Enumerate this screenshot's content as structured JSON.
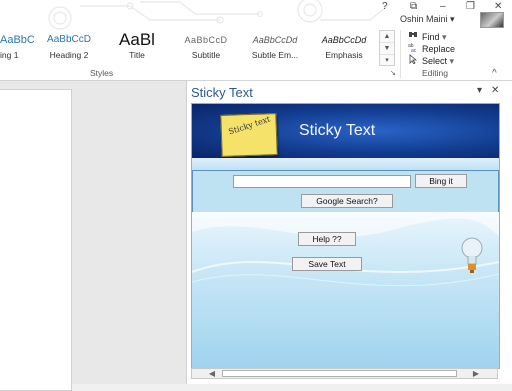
{
  "window": {
    "help": "?",
    "restore": "⧉",
    "minimize": "–",
    "maximize": "❐",
    "close": "✕",
    "user_name": "Oshin Maini",
    "user_menu_arrow": "▾"
  },
  "ribbon": {
    "styles": {
      "items": [
        {
          "sample": "AaBbCc",
          "name": "ing 1"
        },
        {
          "sample": "AaBbCcD",
          "name": "Heading 2"
        },
        {
          "sample": "AaBl",
          "name": "Title"
        },
        {
          "sample": "AaBbCcD",
          "name": "Subtitle"
        },
        {
          "sample": "AaBbCcDd",
          "name": "Subtle Em..."
        },
        {
          "sample": "AaBbCcDd",
          "name": "Emphasis"
        }
      ],
      "scroll_up": "▲",
      "scroll_down": "▼",
      "more": "▾",
      "group_label": "Styles",
      "launcher": "↘"
    },
    "editing": {
      "find": "Find",
      "find_arrow": "▾",
      "replace": "Replace",
      "select": "Select",
      "select_arrow": "▾",
      "group_label": "Editing",
      "collapse": "^"
    }
  },
  "pane": {
    "title": "Sticky Text",
    "menu_arrow": "▾",
    "close": "✕",
    "addin": {
      "note_text": "Sticky text",
      "banner_title": "Sticky Text",
      "search_value": "",
      "bing_button": "Bing it",
      "google_button": "Google Search?",
      "help_button": "Help ??",
      "save_button": "Save Text"
    },
    "scroll_left": "◀",
    "scroll_right": "▶"
  },
  "colors": {
    "accent": "#2b579a",
    "banner": "#1a4aa8",
    "note": "#f4e26b"
  }
}
